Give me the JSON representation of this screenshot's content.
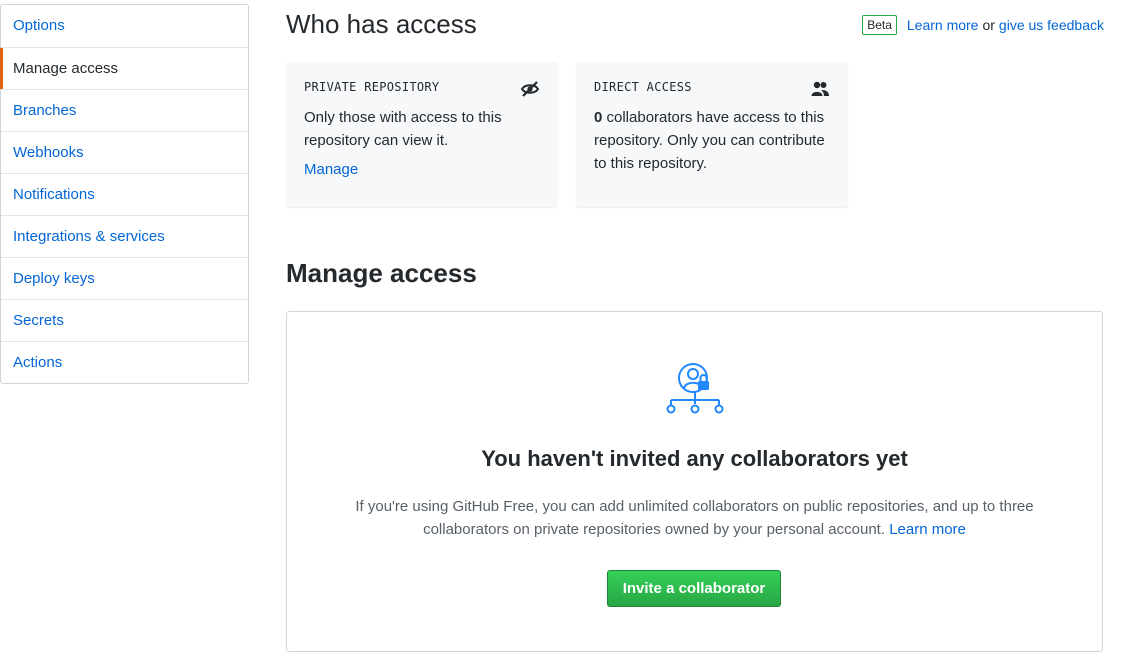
{
  "sidebar": {
    "items": [
      {
        "label": "Options"
      },
      {
        "label": "Manage access",
        "selected": true
      },
      {
        "label": "Branches"
      },
      {
        "label": "Webhooks"
      },
      {
        "label": "Notifications"
      },
      {
        "label": "Integrations & services"
      },
      {
        "label": "Deploy keys"
      },
      {
        "label": "Secrets"
      },
      {
        "label": "Actions"
      }
    ]
  },
  "header": {
    "title": "Who has access",
    "beta": "Beta",
    "learn_more": "Learn more",
    "or": "or",
    "feedback": "give us feedback"
  },
  "cards": {
    "private": {
      "label": "PRIVATE REPOSITORY",
      "icon": "eye-closed-icon",
      "desc": "Only those with access to this repository can view it.",
      "manage": "Manage"
    },
    "direct": {
      "label": "DIRECT ACCESS",
      "icon": "people-icon",
      "count": "0",
      "desc": " collaborators have access to this repository. Only you can contribute to this repository."
    }
  },
  "manage": {
    "title": "Manage access",
    "blank_title": "You haven't invited any collaborators yet",
    "blank_text": "If you're using GitHub Free, you can add unlimited collaborators on public repositories, and up to three collaborators on private repositories owned by your personal account.",
    "learn_more": "Learn more",
    "invite_button": "Invite a collaborator"
  },
  "colors": {
    "link": "#0366d6",
    "accent": "#e36209",
    "button": "#28a745"
  }
}
